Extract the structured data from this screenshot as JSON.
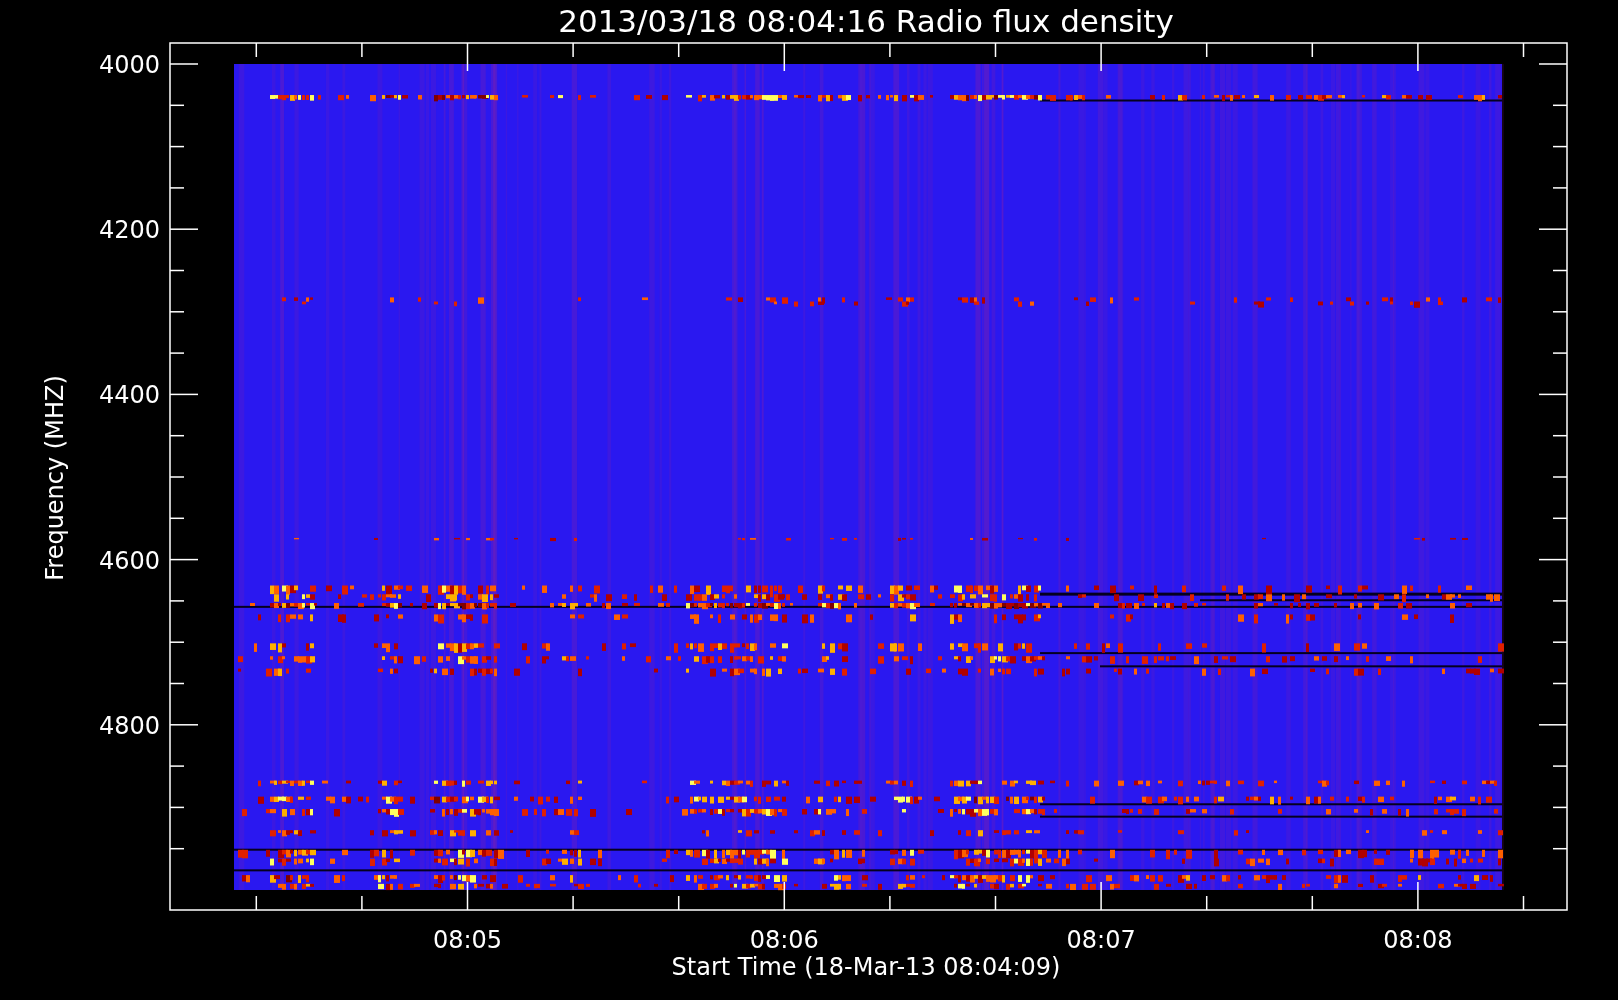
{
  "chart": {
    "title": "2013/03/18 08:04:16 Radio flux density",
    "ylabel": "Frequency (MHZ)",
    "xlabel": "Start Time (18-Mar-13 08:04:09)",
    "yticks": [
      "4000",
      "4200",
      "4400",
      "4600",
      "4800"
    ],
    "xticks": [
      "08:05",
      "08:06",
      "08:07",
      "08:08"
    ]
  }
}
